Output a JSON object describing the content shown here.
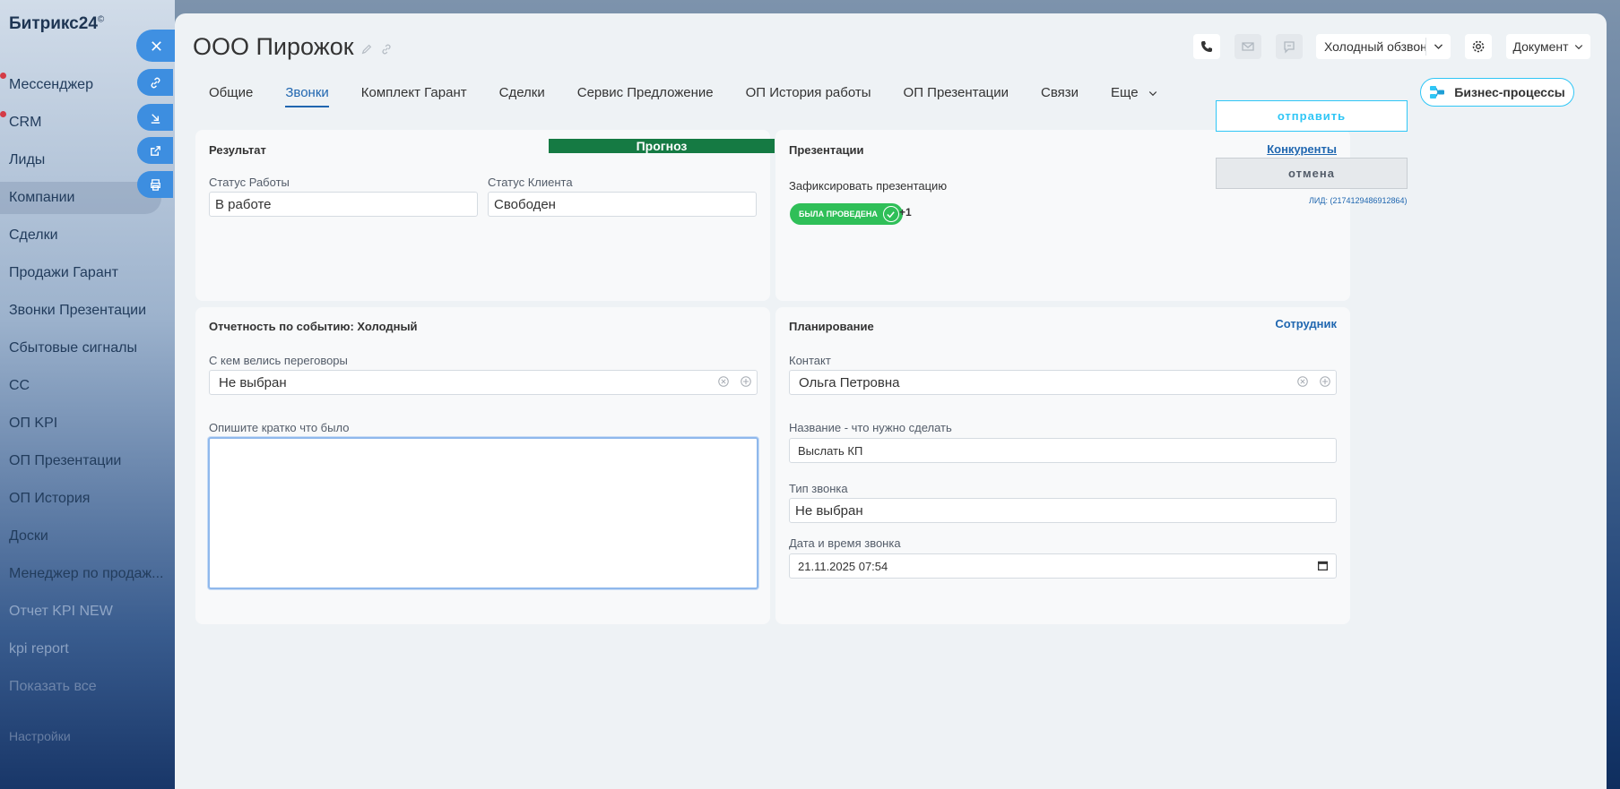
{
  "sidebar": {
    "brand": "Битрикс24",
    "brand_mark": "©",
    "items": [
      {
        "label": "Мессенджер"
      },
      {
        "label": "CRM"
      },
      {
        "label": "Лиды"
      },
      {
        "label": "Компании"
      },
      {
        "label": "Сделки"
      },
      {
        "label": "Продажи Гарант"
      },
      {
        "label": "Звонки Презентации"
      },
      {
        "label": "Сбытовые сигналы"
      },
      {
        "label": "СС"
      },
      {
        "label": "ОП KPI"
      },
      {
        "label": "ОП Презентации"
      },
      {
        "label": "ОП История"
      },
      {
        "label": "Доски"
      },
      {
        "label": "Менеджер по продаж..."
      },
      {
        "label": "Отчет KPI NEW"
      },
      {
        "label": "kpi report"
      },
      {
        "label": "Показать все"
      },
      {
        "label": "Настройки"
      }
    ]
  },
  "header": {
    "title": "ООО Пирожок",
    "scenario": "Холодный обзвон",
    "document": "Документ"
  },
  "tabs": [
    {
      "label": "Общие"
    },
    {
      "label": "Звонки"
    },
    {
      "label": "Комплект Гарант"
    },
    {
      "label": "Сделки"
    },
    {
      "label": "Сервис Предложение"
    },
    {
      "label": "ОП История работы"
    },
    {
      "label": "ОП Презентации"
    },
    {
      "label": "Связи"
    },
    {
      "label": "Еще"
    }
  ],
  "bp_button": "Бизнес-процессы",
  "result": {
    "title": "Результат",
    "forecast": "Прогноз",
    "work_status_label": "Статус Работы",
    "work_status": "В работе",
    "client_status_label": "Статус Клиента",
    "client_status": "Свободен"
  },
  "presentations": {
    "title": "Презентации",
    "link": "Конкуренты",
    "fix_label": "Зафиксировать презентацию",
    "tag": "БЫЛА ПРОВЕДЕНА",
    "more": "+1"
  },
  "report": {
    "title": "Отчетность по событию: Холодный",
    "talk_label": "С кем велись переговоры",
    "talk_value": "Не выбран",
    "desc_label": "Опишите кратко что было"
  },
  "planning": {
    "title": "Планирование",
    "link": "Сотрудник",
    "contact_label": "Контакт",
    "contact_value": "Ольга Петровна",
    "task_label": "Название - что нужно сделать",
    "task_value": "Выслать КП",
    "call_type_label": "Тип звонка",
    "call_type_value": "Не выбран",
    "datetime_label": "Дата и время звонка",
    "datetime_value": "21.11.2025 07:54"
  },
  "actions": {
    "send": "отправить",
    "cancel": "отмена",
    "lead_id": "ЛИД: (2174129486912864)"
  },
  "colors": {
    "accent": "#2066b0",
    "forecast": "#157a43",
    "tag": "#2fbf58",
    "send_border": "#2fc6f6"
  }
}
